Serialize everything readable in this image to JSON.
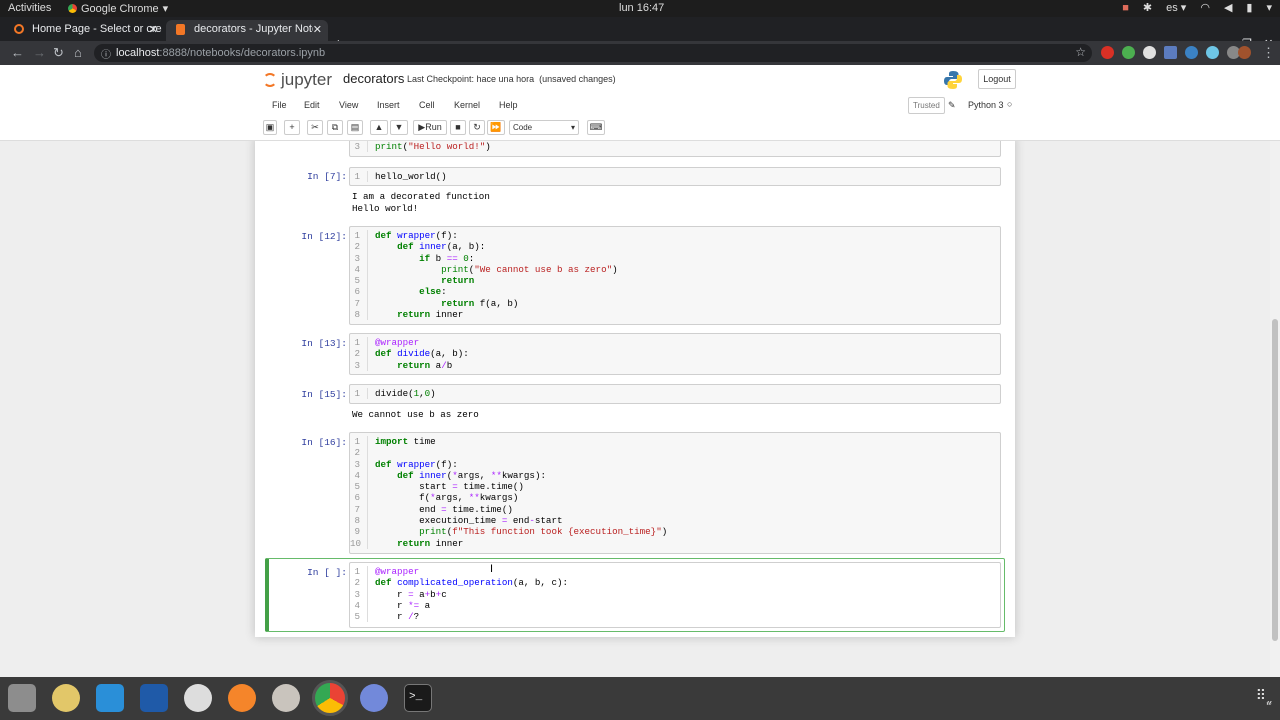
{
  "topbar": {
    "activities": "Activities",
    "app": "Google Chrome",
    "clock": "lun 16:47",
    "lang": "es"
  },
  "tabs": [
    {
      "title": "Home Page - Select or cre"
    },
    {
      "title": "decorators - Jupyter Note"
    }
  ],
  "address": {
    "host": "localhost",
    "path": ":8888/notebooks/decorators.ipynb"
  },
  "jupyter": {
    "logo": "jupyter",
    "notebook_name": "decorators",
    "checkpoint": "Last Checkpoint: hace una hora  (unsaved changes)",
    "logout": "Logout",
    "menu": [
      "File",
      "Edit",
      "View",
      "Insert",
      "Cell",
      "Kernel",
      "Help"
    ],
    "trusted": "Trusted",
    "kernel": "Python 3",
    "run": "Run",
    "cell_type": "Code"
  },
  "cells": [
    {
      "prompt": "",
      "lines": [
        "print(\"Hello world!\")"
      ],
      "start": 3
    },
    {
      "prompt": "In [7]:",
      "lines": [
        "hello_world()"
      ],
      "output": "I am a decorated function\nHello world!"
    },
    {
      "prompt": "In [12]:",
      "lines": [
        "def wrapper(f):",
        "    def inner(a, b):",
        "        if b == 0:",
        "            print(\"We cannot use b as zero\")",
        "            return",
        "        else:",
        "            return f(a, b)",
        "    return inner"
      ]
    },
    {
      "prompt": "In [13]:",
      "lines": [
        "@wrapper",
        "def divide(a, b):",
        "    return a/b"
      ]
    },
    {
      "prompt": "In [15]:",
      "lines": [
        "divide(1,0)"
      ],
      "output": "We cannot use b as zero"
    },
    {
      "prompt": "In [16]:",
      "lines": [
        "import time",
        "",
        "def wrapper(f):",
        "    def inner(*args, **kwargs):",
        "        start = time.time()",
        "        f(*args, **kwargs)",
        "        end = time.time()",
        "        execution_time = end-start",
        "        print(f\"This function took {execution_time}\")",
        "    return inner"
      ]
    },
    {
      "prompt": "In [ ]:",
      "lines": [
        "@wrapper",
        "def complicated_operation(a, b, c):",
        "    r = a+b+c",
        "    r *= a",
        "    r /?"
      ]
    }
  ],
  "dock": [
    "files-icon",
    "rhythmbox-icon",
    "vscode-icon",
    "writer-icon",
    "slack-icon",
    "inkscape-icon",
    "camera-icon",
    "chrome-icon",
    "discord-icon",
    "terminal-icon"
  ],
  "colors": {
    "accent": "#43a047",
    "prompt": "#303f9f",
    "keyword": "#008000",
    "string": "#ba2121"
  }
}
